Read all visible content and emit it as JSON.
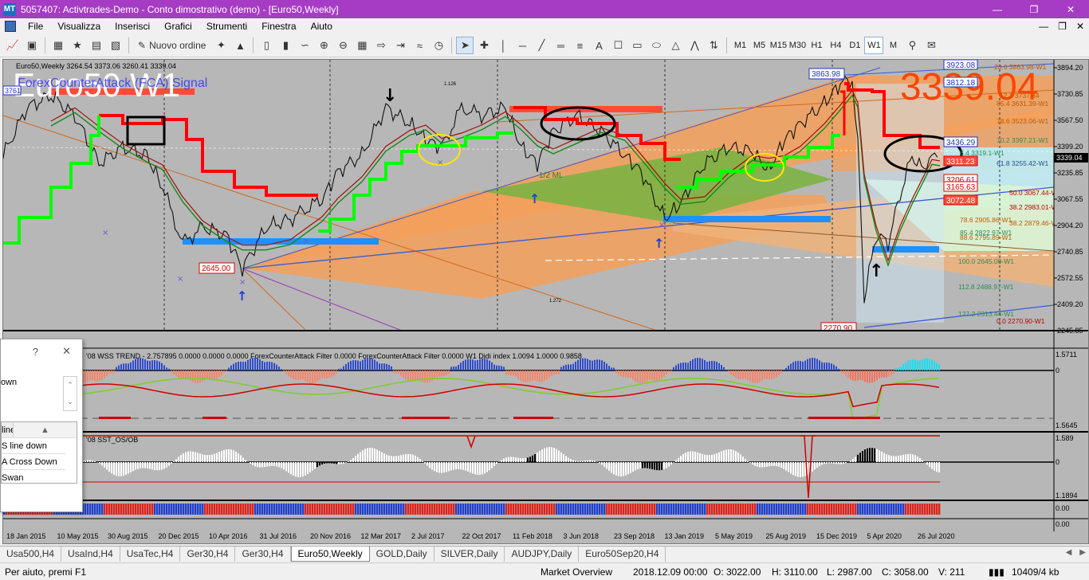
{
  "window": {
    "title": "5057407: Activtrades-Demo - Conto dimostrativo (demo) - [Euro50,Weekly]",
    "app_icon_text": "MT"
  },
  "menu": [
    "File",
    "Visualizza",
    "Inserisci",
    "Grafici",
    "Strumenti",
    "Finestra",
    "Aiuto"
  ],
  "toolbar": {
    "new_order_label": "Nuovo ordine",
    "timeframes": [
      "M1",
      "M5",
      "M15",
      "M30",
      "H1",
      "H4",
      "D1",
      "W1",
      "M"
    ],
    "active_timeframe": "W1"
  },
  "chart": {
    "header": "Euro50,Weekly  3264.54 3373.06 3260.41 3339.04",
    "big_symbol": "Euro50 W1",
    "subtitle": "ForexCounterAttack (FCA) Signal",
    "big_price": "3339.04",
    "current_price": "3339.04",
    "colors": {
      "background": "#b7b7b7",
      "resistance": "#ff0000",
      "support": "#00ff00",
      "big_price": "#ff4500",
      "blue_level": "#1e90ff",
      "orange_zone": "#f5a05a",
      "green_zone": "#7cb342"
    },
    "price_axis": [
      "3894.20",
      "3730.85",
      "3567.50",
      "3399.20",
      "3235.85",
      "3067.55",
      "2904.20",
      "2740.85",
      "2572.55",
      "2409.20",
      "2245.85"
    ],
    "time_axis": [
      "18 Jan 2015",
      "10 May 2015",
      "30 Aug 2015",
      "20 Dec 2015",
      "10 Apr 2016",
      "31 Jul 2016",
      "20 Nov 2016",
      "12 Mar 2017",
      "2 Jul 2017",
      "22 Oct 2017",
      "11 Feb 2018",
      "3 Jun 2018",
      "23 Sep 2018",
      "13 Jan 2019",
      "5 May 2019",
      "25 Aug 2019",
      "15 Dec 2019",
      "5 Apr 2020",
      "26 Jul 2020"
    ],
    "price_labels": {
      "low_2016": "2645.00",
      "high_2020": "3863.98",
      "low_2020": "2270.90",
      "level_3923": "3923.08",
      "level_3812": "3812.18",
      "level_3436": "3436.29",
      "level_3311": "3311.23",
      "level_3206": "3206.61",
      "level_3165": "3165.63",
      "level_3072": "3072.48",
      "left_edge": "3761"
    },
    "fibo_labels": [
      "23.6 3863.98-W1",
      "12.2 3737.84",
      "85.4 3631.39-W1",
      "78.6 3523.06-W1",
      "70.2 3397.21-W1",
      "5.4 3319.1-W1",
      "61.8 3255.42-W1",
      "50.0 3067.44-W1",
      "38.2 2983.01-W1",
      "78.6 2905.86-W1",
      "38.2 2879.46-W1",
      "85.4 2822.97-W1",
      "88.6 2795.89-W1",
      "100.0 2645.00-W1",
      "112.8 2488.97-W1",
      "127.2 2313.44-W1",
      "0.0 2270.90-W1"
    ],
    "annotation_ml": "1/2 ML",
    "annotation_small": "1.126",
    "annotation_small2": "1.272"
  },
  "indicator1": {
    "header": "'08  WSS TREND - 2.757895 0.0000 0.0000 0.0000  ForexCounterAttack  Filter 0.0000  ForexCounterAttack  Filter 0.0000  W1 Didi index 1.0094 1.0000 0.9858",
    "axis_top": "1.5711",
    "axis_zero": "0",
    "axis_bottom": "1.5645"
  },
  "indicator2": {
    "header": "'08  SST_OS/OB",
    "axis_top": "1.589",
    "axis_zero": "0",
    "axis_bottom": "1.1894"
  },
  "indicator3": {
    "axis_top": "0.00",
    "axis_bottom": "0.00"
  },
  "dialog": {
    "help": "?",
    "close": "✕",
    "current_value": "own",
    "options": [
      "line down",
      "S line down",
      "A Cross Down",
      "Swan"
    ]
  },
  "tabs": [
    "Usa500,H4",
    "UsaInd,H4",
    "UsaTec,H4",
    "Ger30,H4",
    "Ger30,H4",
    "Euro50,Weekly",
    "GOLD,Daily",
    "SILVER,Daily",
    "AUDJPY,Daily",
    "Euro50Sep20,H4"
  ],
  "active_tab": "Euro50,Weekly",
  "status": {
    "help": "Per aiuto, premi F1",
    "profile": "Market Overview",
    "datetime": "2018.12.09 00:00",
    "open": "O: 3022.00",
    "high": "H: 3110.00",
    "low": "L: 2987.00",
    "close": "C: 3058.00",
    "volume": "V: 211",
    "traffic": "10409/4 kb"
  }
}
